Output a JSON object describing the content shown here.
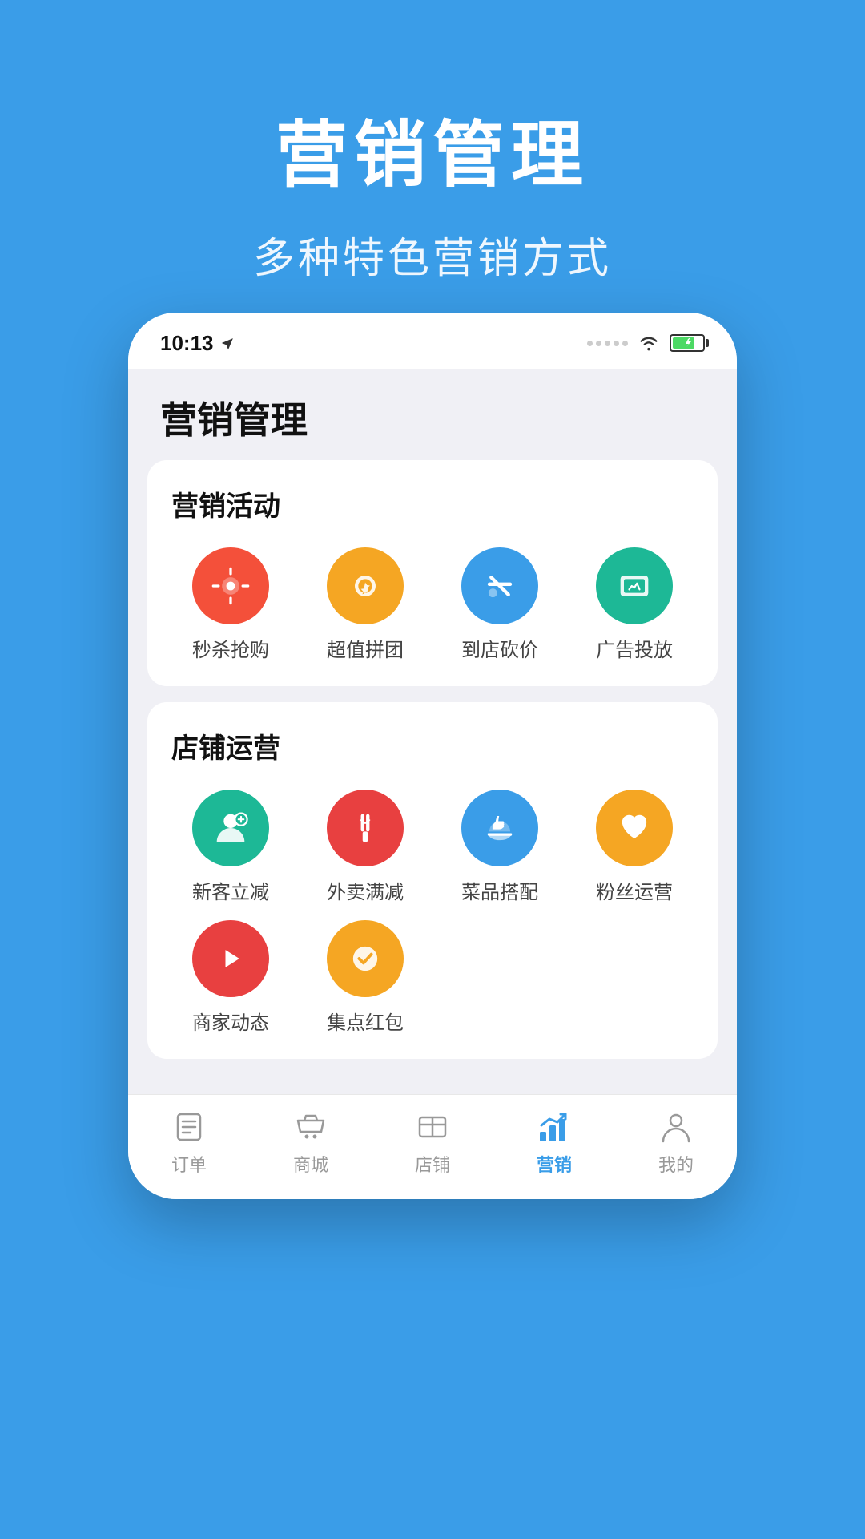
{
  "background_color": "#3a9de8",
  "hero": {
    "title": "营销管理",
    "subtitle": "多种特色营销方式"
  },
  "status_bar": {
    "time": "10:13",
    "location_arrow": "▶"
  },
  "page": {
    "title": "营销管理"
  },
  "marketing_section": {
    "title": "营销活动",
    "items": [
      {
        "id": "flash-sale",
        "label": "秒杀抢购",
        "bg": "bg-red",
        "icon": "⚡"
      },
      {
        "id": "group-buy",
        "label": "超值拼团",
        "bg": "bg-orange",
        "icon": "⚙"
      },
      {
        "id": "in-store-cut",
        "label": "到店砍价",
        "bg": "bg-blue",
        "icon": "✏"
      },
      {
        "id": "ad-placement",
        "label": "广告投放",
        "bg": "bg-teal",
        "icon": "💬"
      }
    ]
  },
  "store_section": {
    "title": "店铺运营",
    "items_row1": [
      {
        "id": "new-customer",
        "label": "新客立减",
        "bg": "bg-green-person",
        "icon": "👤"
      },
      {
        "id": "delivery-discount",
        "label": "外卖满减",
        "bg": "bg-red-fork",
        "icon": "🍴"
      },
      {
        "id": "dish-combo",
        "label": "菜品搭配",
        "bg": "bg-blue-thumb",
        "icon": "👍"
      },
      {
        "id": "fan-ops",
        "label": "粉丝运营",
        "bg": "bg-orange-heart",
        "icon": "♥"
      }
    ],
    "items_row2": [
      {
        "id": "merchant-news",
        "label": "商家动态",
        "bg": "bg-red-video",
        "icon": "▶"
      },
      {
        "id": "stamp-red-envelope",
        "label": "集点红包",
        "bg": "bg-orange-star",
        "icon": "✓"
      }
    ]
  },
  "bottom_nav": {
    "items": [
      {
        "id": "orders",
        "label": "订单",
        "active": false
      },
      {
        "id": "shop",
        "label": "商城",
        "active": false
      },
      {
        "id": "store",
        "label": "店铺",
        "active": false
      },
      {
        "id": "marketing",
        "label": "营销",
        "active": true
      },
      {
        "id": "mine",
        "label": "我的",
        "active": false
      }
    ]
  }
}
